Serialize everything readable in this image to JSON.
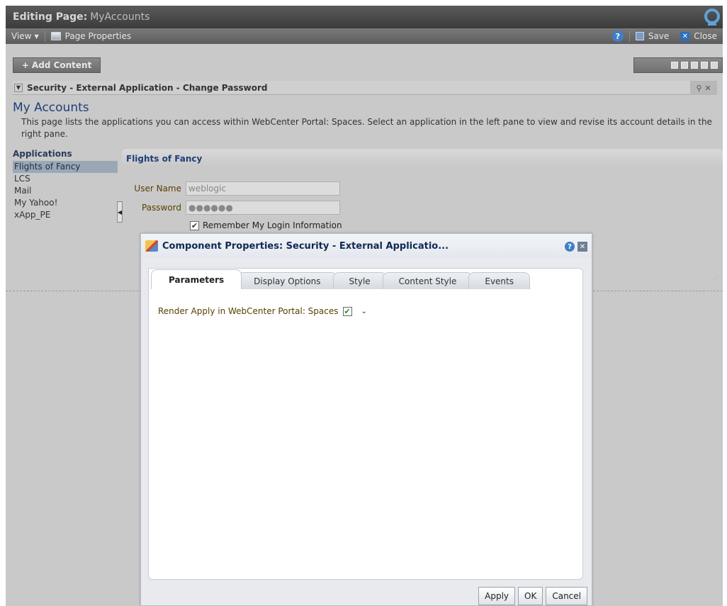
{
  "titlebar": {
    "label": "Editing Page:",
    "page_name": "MyAccounts"
  },
  "toolbar": {
    "view_label": "View",
    "page_properties": "Page Properties",
    "save": "Save",
    "close": "Close",
    "help": "?"
  },
  "editor": {
    "add_content": "+ Add Content"
  },
  "component": {
    "title": "Security - External Application - Change Password",
    "tools": "⚲ ✕"
  },
  "page": {
    "heading": "My Accounts",
    "description": "This page lists the applications you can access within WebCenter Portal: Spaces. Select an application in the left pane to view and revise its account details in the right pane."
  },
  "applications": {
    "title": "Applications",
    "items": [
      "Flights of Fancy",
      "LCS",
      "Mail",
      "My Yahoo!",
      "xApp_PE"
    ],
    "selected": "Flights of Fancy"
  },
  "details": {
    "title": "Flights of Fancy",
    "username_label": "User Name",
    "username_value": "weblogic",
    "password_label": "Password",
    "password_value": "●●●●●●",
    "remember_label": "Remember My Login Information",
    "remember_checked": true
  },
  "dialog": {
    "title": "Component Properties: Security - External Applicatio...",
    "tabs": [
      "Parameters",
      "Display Options",
      "Style",
      "Content Style",
      "Events"
    ],
    "active_tab": "Parameters",
    "param_label": "Render Apply in WebCenter Portal: Spaces",
    "param_checked": true,
    "buttons": {
      "apply": "Apply",
      "ok": "OK",
      "cancel": "Cancel"
    }
  },
  "icons": {
    "logo": "oracle-logo",
    "view_caret": "chevron-down-icon",
    "page_props": "properties-icon",
    "help": "help-icon",
    "save": "save-icon",
    "close": "close-icon"
  },
  "colors": {
    "accent": "#3f7fc8",
    "heading": "#1e3f7a",
    "label": "#5a4000",
    "selection": "#9aa8b6"
  }
}
